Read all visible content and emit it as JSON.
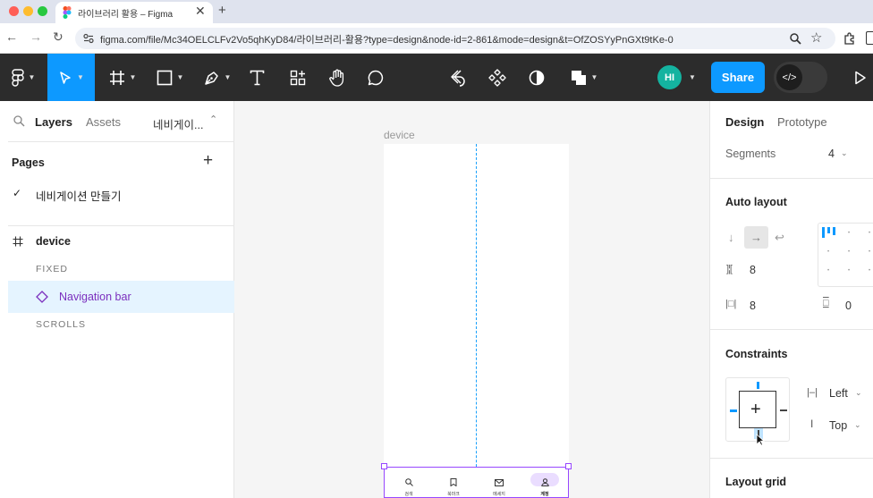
{
  "browser": {
    "tab_title": "라이브러리 활용 – Figma",
    "tab_close": "✕",
    "new_tab": "+",
    "url": "figma.com/file/Mc34OELCLFv2Vo5qhKyD84/라이브러리-활용?type=design&node-id=2-861&mode=design&t=OfZOSYyPnGXt9tKe-0"
  },
  "toolbar": {
    "share_label": "Share",
    "avatar_initials": "HI",
    "dev_mode_label": "</>"
  },
  "left_panel": {
    "tabs": [
      "Layers",
      "Assets"
    ],
    "page_dropdown": "네비게이...",
    "pages_title": "Pages",
    "pages": [
      {
        "name": "네비게이션 만들기",
        "selected": true
      }
    ],
    "layers": {
      "frame_name": "device",
      "sections": [
        "FIXED",
        "SCROLLS"
      ],
      "selected_layer": "Navigation bar"
    }
  },
  "canvas": {
    "frame_label": "device",
    "nav_items": [
      "검색",
      "북마크",
      "메세지",
      "계정"
    ]
  },
  "right_panel": {
    "tabs": [
      "Design",
      "Prototype"
    ],
    "segments_label": "Segments",
    "segments_value": "4",
    "auto_layout_title": "Auto layout",
    "gap_value": "8",
    "padding_h_value": "8",
    "padding_v_value": "0",
    "constraints_title": "Constraints",
    "constraint_h": "Left",
    "constraint_v": "Top",
    "layout_grid_title": "Layout grid"
  },
  "colors": {
    "accent": "#0d99ff",
    "selection": "#9747ff",
    "component": "#7b2fbe",
    "toolbar_bg": "#2c2c2c",
    "selected_tool": "#0d99ff"
  }
}
